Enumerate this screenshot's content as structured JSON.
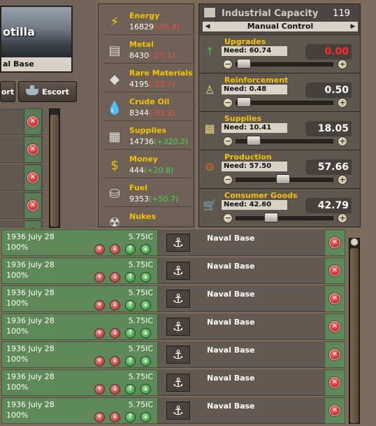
{
  "left": {
    "flotilla_title": "otilla",
    "base_label": "al Base",
    "tabs": [
      {
        "label": "ort"
      },
      {
        "label": "Escort"
      }
    ]
  },
  "resources": [
    {
      "name": "Energy",
      "value": "16829",
      "delta": "(-55.4)",
      "sign": "neg",
      "icon": "lightning-icon"
    },
    {
      "name": "Metal",
      "value": "8430",
      "delta": "(-25.1)",
      "sign": "neg",
      "icon": "metal-bars-icon"
    },
    {
      "name": "Rare Materials",
      "value": "4195",
      "delta": "(-23.7)",
      "sign": "neg",
      "icon": "gems-icon"
    },
    {
      "name": "Crude Oil",
      "value": "8344",
      "delta": "(-33.3)",
      "sign": "neg",
      "icon": "oil-drop-icon"
    },
    {
      "name": "Supplies",
      "value": "14736",
      "delta": "(+320.2)",
      "sign": "pos",
      "icon": "crates-icon"
    },
    {
      "name": "Money",
      "value": "444",
      "delta": "(+20.8)",
      "sign": "pos",
      "icon": "dollar-icon"
    },
    {
      "name": "Fuel",
      "value": "9353",
      "delta": "(+50.7)",
      "sign": "pos",
      "icon": "barrels-icon"
    },
    {
      "name": "Nukes",
      "value": "",
      "delta": "",
      "sign": "",
      "icon": "radiation-icon"
    }
  ],
  "ic": {
    "title": "Industrial Capacity",
    "total": "119",
    "mode": "Manual Control",
    "slots": [
      {
        "name": "Upgrades",
        "need": "Need: 60.74",
        "value": "0.00",
        "zero": true,
        "level": 0.02,
        "icon": "arrow-up-icon"
      },
      {
        "name": "Reinforcement",
        "need": "Need: 0.48",
        "value": "0.50",
        "zero": false,
        "level": 0.02,
        "icon": "soldiers-icon"
      },
      {
        "name": "Supplies",
        "need": "Need: 10.41",
        "value": "18.05",
        "zero": false,
        "level": 0.13,
        "icon": "crates-icon"
      },
      {
        "name": "Production",
        "need": "Need: 57.50",
        "value": "57.66",
        "zero": false,
        "level": 0.48,
        "icon": "gears-icon"
      },
      {
        "name": "Consumer Goods",
        "need": "Need: 42.60",
        "value": "42.79",
        "zero": false,
        "level": 0.34,
        "icon": "cart-icon"
      }
    ]
  },
  "queue": [
    {
      "date": "1936 July 28",
      "pct": "100%",
      "ic": "5.75IC",
      "unit": "Naval Base"
    },
    {
      "date": "1936 July 28",
      "pct": "100%",
      "ic": "5.75IC",
      "unit": "Naval Base"
    },
    {
      "date": "1936 July 28",
      "pct": "100%",
      "ic": "5.75IC",
      "unit": "Naval Base"
    },
    {
      "date": "1936 July 28",
      "pct": "100%",
      "ic": "5.75IC",
      "unit": "Naval Base"
    },
    {
      "date": "1936 July 28",
      "pct": "100%",
      "ic": "5.75IC",
      "unit": "Naval Base"
    },
    {
      "date": "1936 July 28",
      "pct": "100%",
      "ic": "5.75IC",
      "unit": "Naval Base"
    },
    {
      "date": "1936 July 28",
      "pct": "100%",
      "ic": "5.75IC",
      "unit": "Naval Base"
    }
  ]
}
